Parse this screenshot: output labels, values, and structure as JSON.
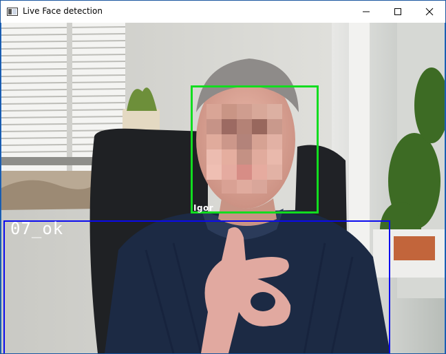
{
  "window": {
    "title": "Live Face detection"
  },
  "icons": {
    "app": "app-window-icon",
    "minimize": "minimize-icon",
    "maximize": "maximize-icon",
    "close": "close-icon"
  },
  "detections": {
    "face_label": "Igor",
    "face_box_color": "#11dd1f",
    "gesture_label": "07_ok",
    "gesture_box_color": "#0a0aee"
  }
}
